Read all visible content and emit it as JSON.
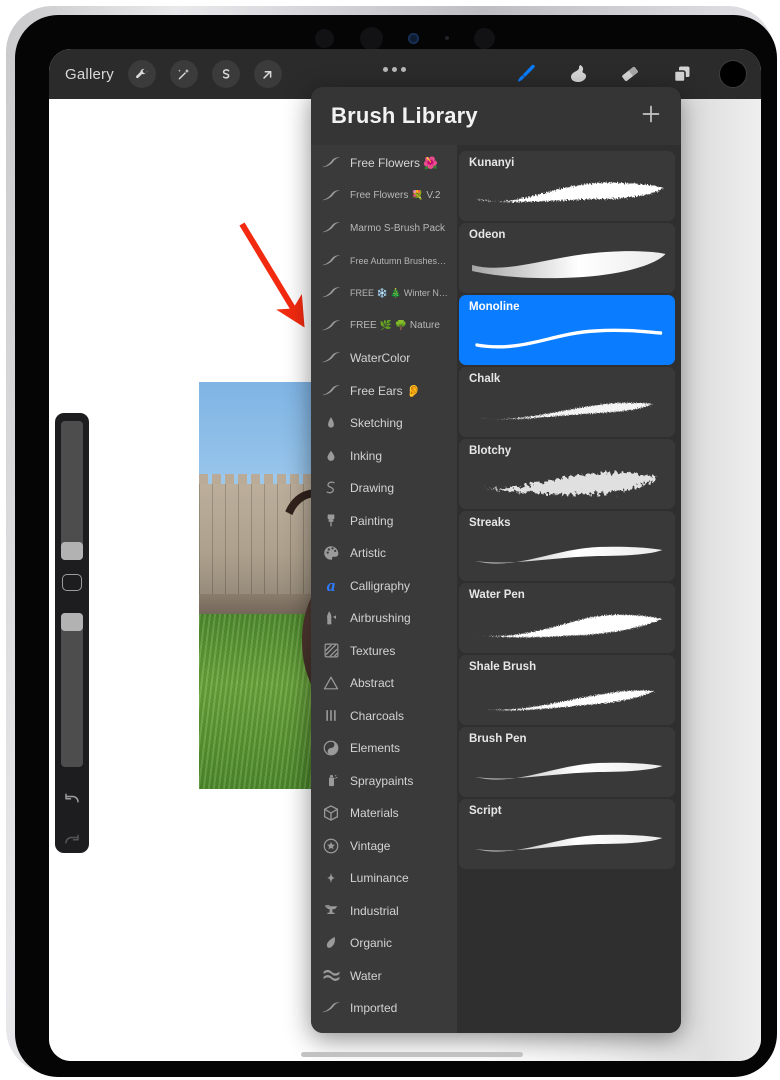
{
  "app": {
    "name": "Procreate",
    "accent_blue": "#0a7cff",
    "panel_bg": "#353535",
    "toolbar_bg": "#2b2b2b"
  },
  "toolbar": {
    "gallery_label": "Gallery",
    "left_tools": [
      {
        "name": "actions-wrench-tool",
        "icon": "wrench-icon"
      },
      {
        "name": "adjustments-tool",
        "icon": "magic-wand-icon"
      },
      {
        "name": "selection-tool",
        "icon": "s-curve-icon"
      },
      {
        "name": "transform-tool",
        "icon": "arrow-diagonal-icon"
      }
    ],
    "more_menu": "more-dots-icon",
    "right_tools": [
      {
        "name": "paint-brush-tool",
        "icon": "paintbrush-icon",
        "active": true
      },
      {
        "name": "smudge-tool",
        "icon": "smudge-icon",
        "active": false
      },
      {
        "name": "eraser-tool",
        "icon": "eraser-icon",
        "active": false
      },
      {
        "name": "layers-tool",
        "icon": "layers-icon",
        "active": false
      }
    ],
    "color_swatch": "#000000"
  },
  "side_controls": {
    "brush_size_slider": "brush-size-slider",
    "modify_button": "modify-button",
    "brush_opacity_slider": "brush-opacity-slider",
    "undo": "undo-icon",
    "redo": "redo-icon"
  },
  "annotation": {
    "arrow_color": "#f22a10"
  },
  "brush_library": {
    "title": "Brush Library",
    "add_label": "+",
    "sets": [
      {
        "label": "Free Flowers 🌺",
        "icon": "brush-stroke-icon",
        "size": "normal"
      },
      {
        "label": "Free Flowers 💐 V.2",
        "icon": "brush-stroke-icon",
        "size": "small"
      },
      {
        "label": "Marmo S-Brush Pack",
        "icon": "brush-stroke-icon",
        "size": "small"
      },
      {
        "label": "Free Autumn Brushes…",
        "icon": "brush-stroke-icon",
        "size": "tiny"
      },
      {
        "label": "FREE ❄️ 🎄 Winter N…",
        "icon": "brush-stroke-icon",
        "size": "tiny"
      },
      {
        "label": "FREE 🌿 🌳 Nature",
        "icon": "brush-stroke-icon",
        "size": "small"
      },
      {
        "label": "WaterColor",
        "icon": "brush-stroke-icon",
        "size": "normal"
      },
      {
        "label": "Free Ears 👂",
        "icon": "brush-stroke-icon",
        "size": "normal"
      },
      {
        "label": "Sketching",
        "icon": "pencil-tip-icon",
        "size": "normal"
      },
      {
        "label": "Inking",
        "icon": "ink-drop-icon",
        "size": "normal"
      },
      {
        "label": "Drawing",
        "icon": "squiggle-icon",
        "size": "normal"
      },
      {
        "label": "Painting",
        "icon": "paint-brush-icon",
        "size": "normal"
      },
      {
        "label": "Artistic",
        "icon": "palette-icon",
        "size": "normal"
      },
      {
        "label": "Calligraphy",
        "icon": "script-a-icon",
        "size": "normal"
      },
      {
        "label": "Airbrushing",
        "icon": "airbrush-icon",
        "size": "normal"
      },
      {
        "label": "Textures",
        "icon": "hatched-square-icon",
        "size": "normal"
      },
      {
        "label": "Abstract",
        "icon": "triangle-icon",
        "size": "normal"
      },
      {
        "label": "Charcoals",
        "icon": "three-bars-icon",
        "size": "normal"
      },
      {
        "label": "Elements",
        "icon": "yin-yang-icon",
        "size": "normal"
      },
      {
        "label": "Spraypaints",
        "icon": "spray-can-icon",
        "size": "normal"
      },
      {
        "label": "Materials",
        "icon": "cube-icon",
        "size": "normal"
      },
      {
        "label": "Vintage",
        "icon": "star-circle-icon",
        "size": "normal"
      },
      {
        "label": "Luminance",
        "icon": "sparkle-icon",
        "size": "normal"
      },
      {
        "label": "Industrial",
        "icon": "anvil-icon",
        "size": "normal"
      },
      {
        "label": "Organic",
        "icon": "leaf-icon",
        "size": "normal"
      },
      {
        "label": "Water",
        "icon": "waves-icon",
        "size": "normal"
      },
      {
        "label": "Imported",
        "icon": "brush-stroke-icon",
        "size": "normal"
      }
    ],
    "brushes": [
      {
        "name": "Kunanyi",
        "selected": false,
        "stroke": "rough-dry"
      },
      {
        "name": "Odeon",
        "selected": false,
        "stroke": "wide-soft"
      },
      {
        "name": "Monoline",
        "selected": true,
        "stroke": "thin-even"
      },
      {
        "name": "Chalk",
        "selected": false,
        "stroke": "grainy-taper"
      },
      {
        "name": "Blotchy",
        "selected": false,
        "stroke": "blotchy-thick"
      },
      {
        "name": "Streaks",
        "selected": false,
        "stroke": "smooth-taper"
      },
      {
        "name": "Water Pen",
        "selected": false,
        "stroke": "wet-taper"
      },
      {
        "name": "Shale Brush",
        "selected": false,
        "stroke": "speckled-taper"
      },
      {
        "name": "Brush Pen",
        "selected": false,
        "stroke": "smooth-taper"
      },
      {
        "name": "Script",
        "selected": false,
        "stroke": "smooth-taper"
      }
    ]
  }
}
